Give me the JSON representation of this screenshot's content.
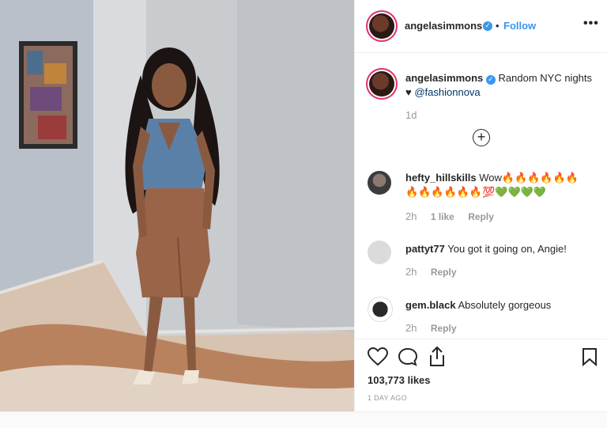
{
  "post": {
    "username": "angelasimmons",
    "follow_label": "Follow",
    "separator": "•",
    "more": "•••",
    "caption_user": "angelasimmons",
    "caption_text": "Random NYC nights ♥ ",
    "caption_mention": "@fashionnova",
    "caption_time": "1d",
    "load_more": "+"
  },
  "comments": [
    {
      "user": "hefty_hillskills",
      "text": "Wow🔥🔥🔥🔥🔥🔥🔥🔥🔥🔥🔥🔥💯💚💚💚💚",
      "time": "2h",
      "likes": "1 like",
      "reply": "Reply"
    },
    {
      "user": "pattyt77",
      "text": "You got it going on, Angie!",
      "time": "2h",
      "reply": "Reply"
    },
    {
      "user": "gem.black",
      "text": "Absolutely gorgeous",
      "time": "2h",
      "reply": "Reply"
    }
  ],
  "footer": {
    "likes": "103,773 likes",
    "date": "1 DAY AGO"
  },
  "colors": {
    "accent": "#3897f0",
    "verified": "#3897f0",
    "ring": "#e1306c"
  }
}
